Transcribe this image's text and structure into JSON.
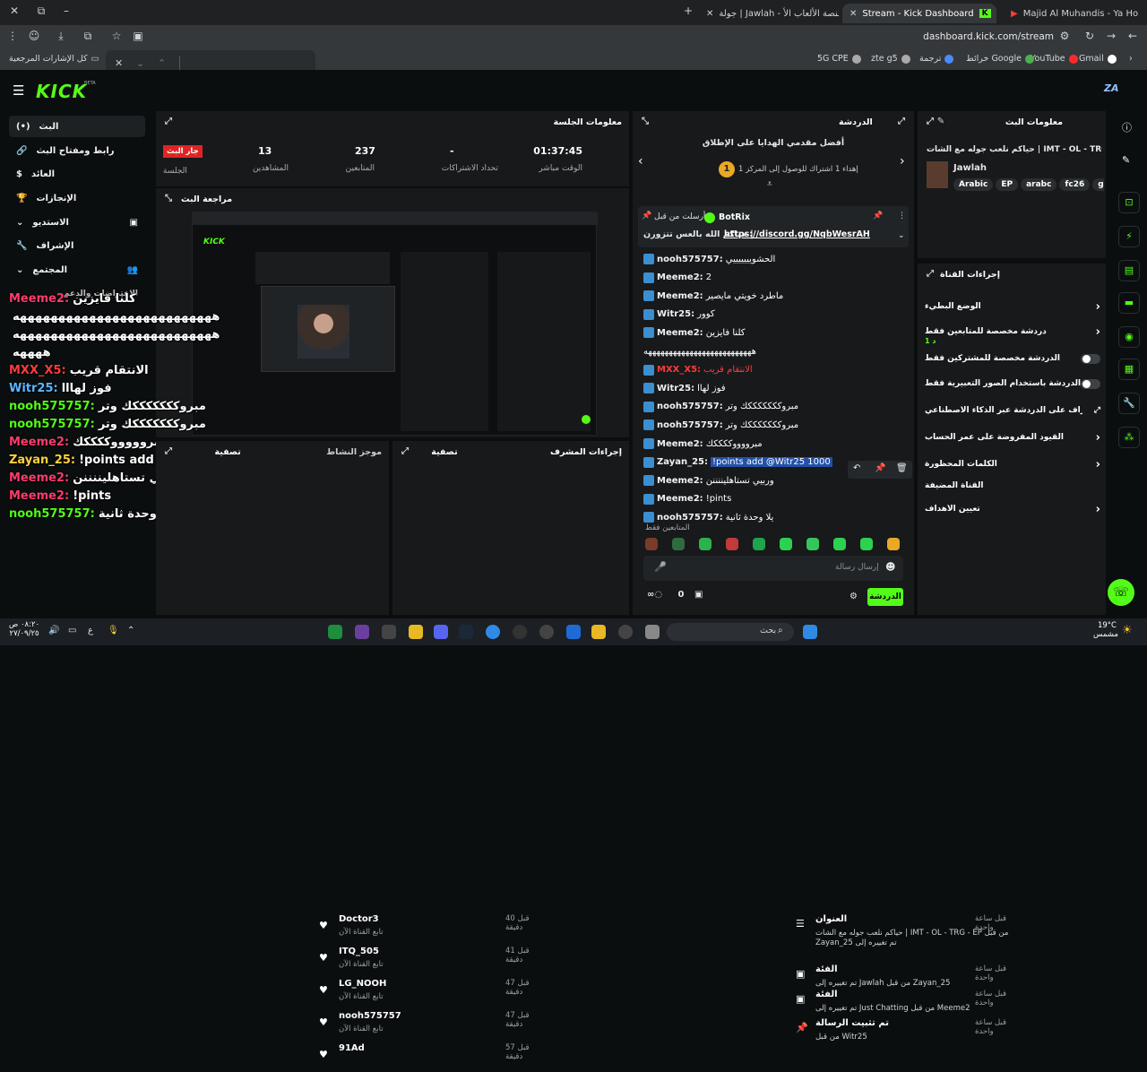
{
  "browser": {
    "tabs": [
      {
        "label": "Majid Al Muhandis - Ya Ho"
      },
      {
        "label": "Stream - Kick Dashboard"
      },
      {
        "label": "جولة | Jawlah - منصة الألعاب الأ"
      }
    ],
    "address": "dashboard.kick.com/stream",
    "bookmarks": [
      "Gmail",
      "YouTube",
      "خرائط Google",
      "ترجمة",
      "zte g5",
      "5G CPE",
      "كل الإشارات المرجعية"
    ]
  },
  "kick": {
    "logo": "KICK",
    "logo_sup": "BETA",
    "user_initials": "ZA"
  },
  "sidebar": {
    "items": [
      {
        "label": "البث",
        "icon": "(•)"
      },
      {
        "label": "رابط ومفتاح البث",
        "icon": "🔗"
      },
      {
        "label": "العائد",
        "icon": "$"
      },
      {
        "label": "الإنجازات",
        "icon": "🏆"
      },
      {
        "label": "الاستديو",
        "icon": "⌄"
      },
      {
        "label": "الإشراف",
        "icon": "🔧"
      },
      {
        "label": "المجتمع",
        "icon": "⌄"
      }
    ],
    "sub_item": "الاعتراضات والدعم"
  },
  "session": {
    "title": "معلومات الجلسة",
    "live_badge": "جار البث",
    "live_label": "الجلسة",
    "stats": [
      {
        "value": "01:37:45",
        "label": "الوقت مباشر"
      },
      {
        "value": "-",
        "label": "تحداد الاشتراكات"
      },
      {
        "value": "237",
        "label": "المتابعين"
      },
      {
        "value": "13",
        "label": "المشاهدين"
      }
    ]
  },
  "preview": {
    "title": "مراجعة البث"
  },
  "overlay": [
    {
      "user": "Meeme2:",
      "text": "كلنا فايزين",
      "color": "#ff3b6b"
    },
    {
      "user": "",
      "text": "ههههههههههههههههههههههههههه",
      "color": "#ffffff"
    },
    {
      "user": "",
      "text": "ههههههههههههههههههههههههههه",
      "color": "#ffffff"
    },
    {
      "user": "",
      "text": "ههههه",
      "color": "#ffffff"
    },
    {
      "user": "MXX_X5:",
      "text": "الانتقام قريب",
      "color": "#ff3b3b"
    },
    {
      "user": "Witr25:",
      "text": "فوز لهااا",
      "color": "#5bb6ff"
    },
    {
      "user": "nooh575757:",
      "text": "مبروكككككككك وتر",
      "color": "#53fc18"
    },
    {
      "user": "nooh575757:",
      "text": "مبروكككككككك وتر",
      "color": "#53fc18"
    },
    {
      "user": "Meeme2:",
      "text": "مبروووووككككك",
      "color": "#ff3b6b"
    },
    {
      "user": "Zayan_25:",
      "text": "!points add @Witr25 1000",
      "color": "#ffd23b"
    },
    {
      "user": "Meeme2:",
      "text": "وربيي تستاهليننننن",
      "color": "#ff3b6b"
    },
    {
      "user": "Meeme2:",
      "text": "!pints",
      "color": "#ff3b6b"
    },
    {
      "user": "nooh575757:",
      "text": "يلا وحدة ثانية",
      "color": "#53fc18"
    }
  ],
  "mod_actions": {
    "title": "إجراءات المشرف",
    "feed_title": "تصفية",
    "items": [
      {
        "time": "قبل ساعة واحدة",
        "title": "العنوان",
        "desc": "حياكم نلعب جوله مع الشات | IMT - OL - TRG - EP من قبل Zayan_25 تم تغييره إلى"
      },
      {
        "time": "قبل ساعة واحدة",
        "title": "الفئة",
        "desc": "تم تغييره إلى Jawlah من قبل Zayan_25"
      },
      {
        "time": "قبل ساعة واحدة",
        "title": "الفئة",
        "desc": "تم تغييره إلى Just Chatting من قبل Meeme2"
      },
      {
        "time": "قبل ساعة واحدة",
        "title": "تم تثبيت الرسالة",
        "desc": "من قبل Witr25"
      }
    ]
  },
  "activity": {
    "title": "تصفية",
    "feed_title": "موجز النشاط",
    "items": [
      {
        "name": "Doctor3",
        "sub": "تابع القناة الآن",
        "time": "قبل 40 دقيقة"
      },
      {
        "name": "ITQ_505",
        "sub": "تابع القناة الآن",
        "time": "قبل 41 دقيقة"
      },
      {
        "name": "LG_NOOH",
        "sub": "تابع القناة الآن",
        "time": "قبل 47 دقيقة"
      },
      {
        "name": "nooh575757",
        "sub": "تابع القناة الآن",
        "time": "قبل 47 دقيقة"
      },
      {
        "name": "91Ad",
        "sub": "",
        "time": "قبل 57 دقيقة"
      }
    ]
  },
  "chat": {
    "title": "الدردشة",
    "gift_title": "أفضل مقدمي الهدايا على الإطلاق",
    "gift_sub": "إهداء 1 اشتراك للوصول إلى المركز 1",
    "gift_rank": "1",
    "pinned_by": "أرسلت من قبل",
    "pinned_user": "BotRix",
    "pinned_text": "حياكم الله بالعس تتزورن |",
    "pinned_link": "https://discord.gg/NqbWesrAH",
    "messages": [
      {
        "user": "nooh575757:",
        "text": "الحشويييييييي",
        "color": "#ffffff"
      },
      {
        "user": "Meeme2:",
        "text": "2",
        "color": "#ffffff"
      },
      {
        "user": "Meeme2:",
        "text": "ماطرد خويتي مايصير",
        "color": "#ffffff"
      },
      {
        "user": "Witr25:",
        "text": "كوور",
        "color": "#ffffff"
      },
      {
        "user": "Meeme2:",
        "text": "كلنا فايزين",
        "color": "#ffffff"
      },
      {
        "user": "",
        "text": "ههههههههههههههههههههههههههه",
        "color": "#ffffff"
      },
      {
        "user": "MXX_X5:",
        "text": "الانتقام قريب",
        "color": "#ff3b3b"
      },
      {
        "user": "Witr25:",
        "text": "فوز لهاا",
        "color": "#ffffff"
      },
      {
        "user": "nooh575757:",
        "text": "مبروكككككككك وتر",
        "color": "#ffffff"
      },
      {
        "user": "nooh575757:",
        "text": "مبروكككككككك وتر",
        "color": "#ffffff"
      },
      {
        "user": "Meeme2:",
        "text": "مبرووووككككك",
        "color": "#ffffff"
      },
      {
        "user": "Zayan_25:",
        "text": "!points add @Witr25 1000",
        "color": "#ffd23b"
      },
      {
        "user": "Meeme2:",
        "text": "وربيي تستاهليننننن",
        "color": "#ffffff"
      },
      {
        "user": "Meeme2:",
        "text": "!pints",
        "color": "#ffffff"
      },
      {
        "user": "nooh575757:",
        "text": "يلا وحدة ثانية",
        "color": "#ffffff"
      }
    ],
    "followers_only": "المتابعين فقط",
    "input_placeholder": "إرسال رسالة",
    "send_label": "الدردشة",
    "count": "0"
  },
  "stream_info": {
    "title": "معلومات البث",
    "stream_title": "حياكم نلعب جوله مع الشات | IMT - OL - TRG - EP",
    "game": "Jawlah",
    "tags": [
      "Arabic",
      "EP",
      "arabc",
      "fc26",
      "g"
    ]
  },
  "channel_actions": {
    "title": "إجراءات القناة",
    "rows": [
      {
        "label": "الوضع البطيء",
        "kind": "chevron"
      },
      {
        "label": "دردشة مخصصة للمتابعين فقط",
        "kind": "chevron",
        "sub": "1 د"
      },
      {
        "label": "الدردشة مخصصة للمشتركين فقط",
        "kind": "toggle"
      },
      {
        "label": "الدردشة باستخدام الصور التعبيرية فقط",
        "kind": "toggle"
      },
      {
        "label": "الإشراف على الدردشة عبر الذكاء الاصطناعي",
        "kind": "ext"
      },
      {
        "label": "القيود المفروضة على عمر الحساب",
        "kind": "chevron"
      },
      {
        "label": "الكلمات المحظورة",
        "kind": "chevron"
      },
      {
        "label": "القناة المضيفة",
        "kind": "none"
      },
      {
        "label": "تعيين الأهداف",
        "kind": "chevron"
      }
    ]
  },
  "taskbar": {
    "search_placeholder": "بحث",
    "weather": "19°C",
    "weather_desc": "مشمس",
    "time": "٠٨:٢٠ ص",
    "date": "٢٧/٠٩/٢٥"
  }
}
